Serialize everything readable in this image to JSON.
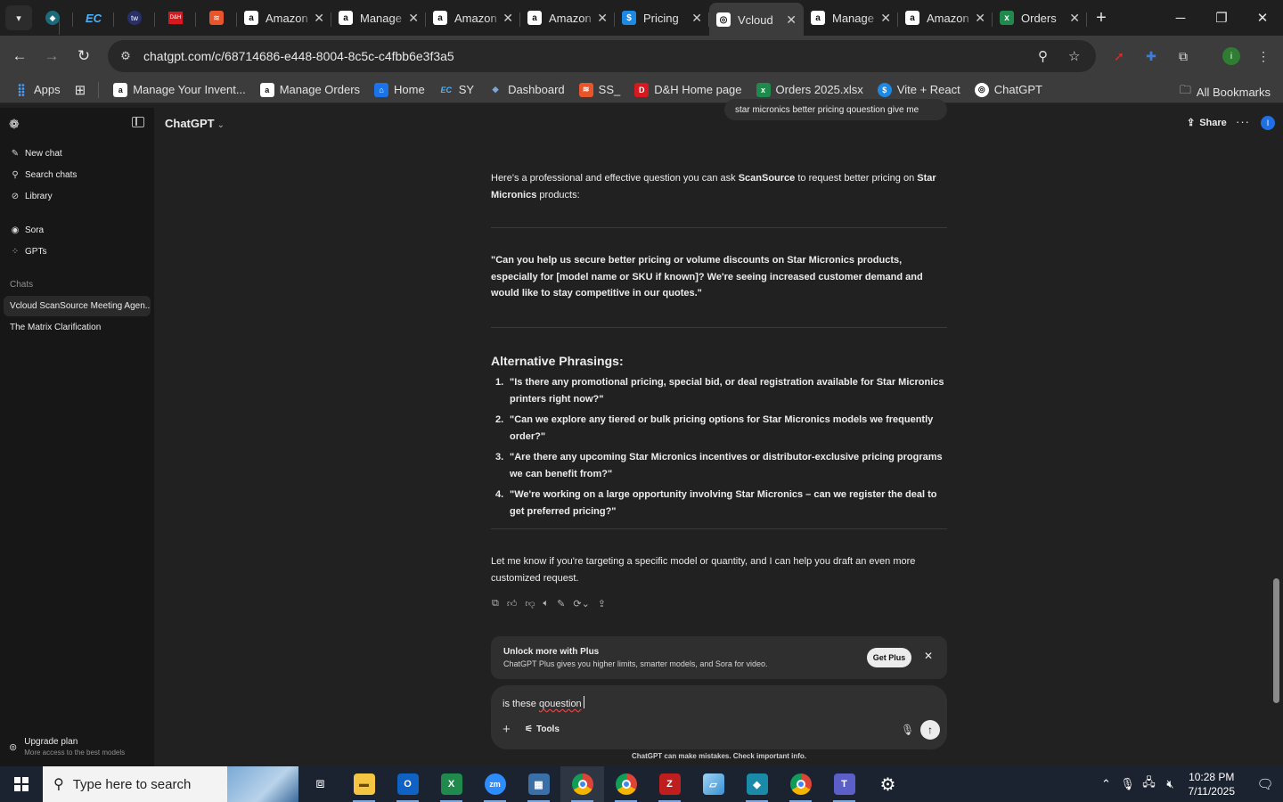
{
  "browser": {
    "tabs": [
      {
        "label": "Amazon",
        "icon": "amazon-icon",
        "cls": "ico-amz",
        "glyph": "a"
      },
      {
        "label": "Manage",
        "icon": "amazon-icon",
        "cls": "ico-amz",
        "glyph": "a"
      },
      {
        "label": "Amazon",
        "icon": "amazon-icon",
        "cls": "ico-amz",
        "glyph": "a"
      },
      {
        "label": "Amazon",
        "icon": "amazon-icon",
        "cls": "ico-amz",
        "glyph": "a"
      },
      {
        "label": "Pricing",
        "icon": "dollar-icon",
        "cls": "ico-pr",
        "glyph": "$"
      },
      {
        "label": "Vcloud",
        "icon": "chatgpt-icon",
        "cls": "ico-gpt",
        "glyph": "◎",
        "active": true
      },
      {
        "label": "Manage",
        "icon": "amazon-icon",
        "cls": "ico-amz",
        "glyph": "a"
      },
      {
        "label": "Amazon",
        "icon": "amazon-icon",
        "cls": "ico-amz",
        "glyph": "a"
      },
      {
        "label": "Orders",
        "icon": "excel-icon",
        "cls": "ico-xl",
        "glyph": "x"
      }
    ],
    "url": "chatgpt.com/c/68714686-e448-8004-8c5c-c4fbb6e3f3a5",
    "bookmarks": [
      {
        "label": "Apps",
        "icon": "apps-grid-icon"
      },
      {
        "label": "Manage Your Invent...",
        "icon": "amazon-icon"
      },
      {
        "label": "Manage Orders",
        "icon": "amazon-icon"
      },
      {
        "label": "Home",
        "icon": "home-icon"
      },
      {
        "label": "SY",
        "icon": "ec-icon"
      },
      {
        "label": "Dashboard",
        "icon": "dashboard-icon"
      },
      {
        "label": "SS_",
        "icon": "ss-icon"
      },
      {
        "label": "D&H Home page",
        "icon": "dh-icon"
      },
      {
        "label": "Orders 2025.xlsx",
        "icon": "excel-icon"
      },
      {
        "label": "Vite + React",
        "icon": "dollar-icon"
      },
      {
        "label": "ChatGPT",
        "icon": "chatgpt-icon"
      }
    ],
    "all_bookmarks": "All Bookmarks"
  },
  "sidebar": {
    "nav": [
      {
        "label": "New chat",
        "icon": "pencil-square-icon"
      },
      {
        "label": "Search chats",
        "icon": "search-icon"
      },
      {
        "label": "Library",
        "icon": "library-icon"
      },
      {
        "label": "Sora",
        "icon": "sora-icon"
      },
      {
        "label": "GPTs",
        "icon": "gpts-icon"
      }
    ],
    "chats_heading": "Chats",
    "chats": [
      "Vcloud ScanSource Meeting Agen...",
      "The Matrix Clarification"
    ],
    "upgrade_title": "Upgrade plan",
    "upgrade_sub": "More access to the best models"
  },
  "header": {
    "model": "ChatGPT",
    "share": "Share",
    "avatar": "I"
  },
  "conversation": {
    "user_bubble": "star micronics  better pricing  qouestion give me",
    "intro_pre": "Here's a professional and effective question you can ask ",
    "intro_b1": "ScanSource",
    "intro_mid": " to request better pricing on ",
    "intro_b2": "Star Micronics",
    "intro_post": " products:",
    "quote": "\"Can you help us secure better pricing or volume discounts on Star Micronics products, especially for [model name or SKU if known]? We're seeing increased customer demand and would like to stay competitive in our quotes.\"",
    "alt_heading": "Alternative Phrasings:",
    "alternatives": [
      "\"Is there any promotional pricing, special bid, or deal registration available for Star Micronics printers right now?\"",
      "\"Can we explore any tiered or bulk pricing options for Star Micronics models we frequently order?\"",
      "\"Are there any upcoming Star Micronics incentives or distributor-exclusive pricing programs we can benefit from?\"",
      "\"We're working on a large opportunity involving Star Micronics – can we register the deal to get preferred pricing?\""
    ],
    "outro": "Let me know if you're targeting a specific model or quantity, and I can help you draft an even more customized request."
  },
  "plus_banner": {
    "title": "Unlock more with Plus",
    "subtitle": "ChatGPT Plus gives you higher limits, smarter models, and Sora for video.",
    "button": "Get Plus"
  },
  "composer": {
    "text_a": "is these ",
    "text_b": "qouestion",
    "tools": "Tools"
  },
  "disclaimer": "ChatGPT can make mistakes. Check important info.",
  "taskbar": {
    "search_placeholder": "Type here to search",
    "time": "10:28 PM",
    "date": "7/11/2025"
  }
}
